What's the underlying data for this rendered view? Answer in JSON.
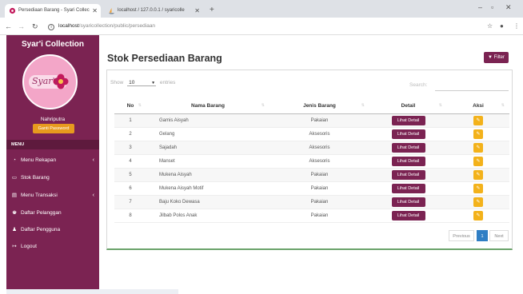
{
  "browser": {
    "tabs": [
      {
        "title": "Persediaan Barang - Syari Collec"
      },
      {
        "title": "localhost / 127.0.0.1 / syaricolle"
      }
    ],
    "url_host": "localhost",
    "url_path": "/syaricollection/public/persediaan"
  },
  "sidebar": {
    "brand": "Syar'i Collection",
    "logo_text": "Syar'i",
    "username": "Nahriputra",
    "change_password": "Ganti Password",
    "menu_header": "MENU",
    "items": [
      {
        "label": "Menu Rekapan",
        "icon": "gauge-icon"
      },
      {
        "label": "Stok Barang",
        "icon": "monitor-icon"
      },
      {
        "label": "Menu Transaksi",
        "icon": "document-icon"
      },
      {
        "label": "Daftar Pelanggan",
        "icon": "users-icon"
      },
      {
        "label": "Daftar Pengguna",
        "icon": "user-icon"
      },
      {
        "label": "Logout",
        "icon": "logout-icon"
      }
    ]
  },
  "main": {
    "title": "Stok Persediaan Barang",
    "filter_label": "Filter",
    "show_label": "Show",
    "show_value": "10",
    "entries_label": "entries",
    "search_label": "Search:",
    "columns": [
      "No",
      "Nama Barang",
      "Jenis Barang",
      "Detail",
      "Aksi"
    ],
    "detail_label": "Lihat Detail",
    "rows": [
      {
        "no": "1",
        "nama": "Gamis Aisyah",
        "jenis": "Pakaian"
      },
      {
        "no": "2",
        "nama": "Gelang",
        "jenis": "Aksesoris"
      },
      {
        "no": "3",
        "nama": "Sajadah",
        "jenis": "Aksesoris"
      },
      {
        "no": "4",
        "nama": "Manset",
        "jenis": "Aksesoris"
      },
      {
        "no": "5",
        "nama": "Mukena Aisyah",
        "jenis": "Pakaian"
      },
      {
        "no": "6",
        "nama": "Mukena Aisyah Motif",
        "jenis": "Pakaian"
      },
      {
        "no": "7",
        "nama": "Baju Koko Dewasa",
        "jenis": "Pakaian"
      },
      {
        "no": "8",
        "nama": "Jilbab Polos Anak",
        "jenis": "Pakaian"
      }
    ],
    "pagination": {
      "previous": "Previous",
      "current": "1",
      "next": "Next"
    }
  },
  "colors": {
    "primary": "#7b2352",
    "accent": "#e79a1e",
    "edit": "#f3b21b",
    "page_active": "#2f7ec4"
  }
}
